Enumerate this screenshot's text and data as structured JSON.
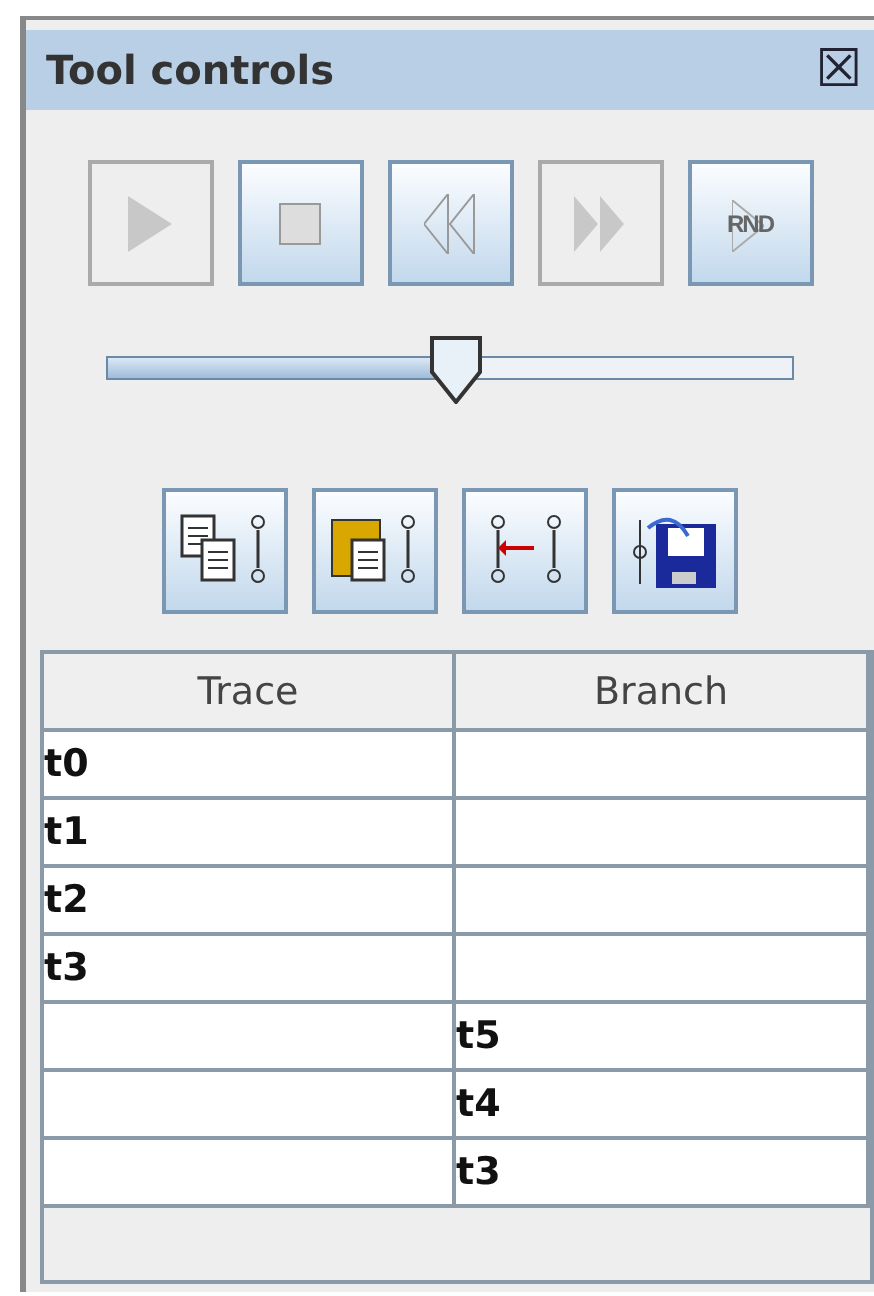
{
  "window": {
    "title": "Tool controls",
    "close": "☒"
  },
  "playback": [
    {
      "kind": "play",
      "disabled": true
    },
    {
      "kind": "stop",
      "disabled": false
    },
    {
      "kind": "rewind",
      "disabled": false
    },
    {
      "kind": "forward",
      "disabled": true
    },
    {
      "kind": "random",
      "label": "RND",
      "disabled": false
    }
  ],
  "slider": {
    "level": 0.51
  },
  "tools": [
    {
      "kind": "copy"
    },
    {
      "kind": "paste"
    },
    {
      "kind": "jump"
    },
    {
      "kind": "save"
    }
  ],
  "table": {
    "columns": [
      "Trace",
      "Branch"
    ],
    "rows": [
      [
        "t0",
        ""
      ],
      [
        "t1",
        ""
      ],
      [
        "t2",
        ""
      ],
      [
        "t3",
        ""
      ],
      [
        "",
        "t5"
      ],
      [
        "",
        "t4"
      ],
      [
        "",
        "t3"
      ]
    ]
  }
}
